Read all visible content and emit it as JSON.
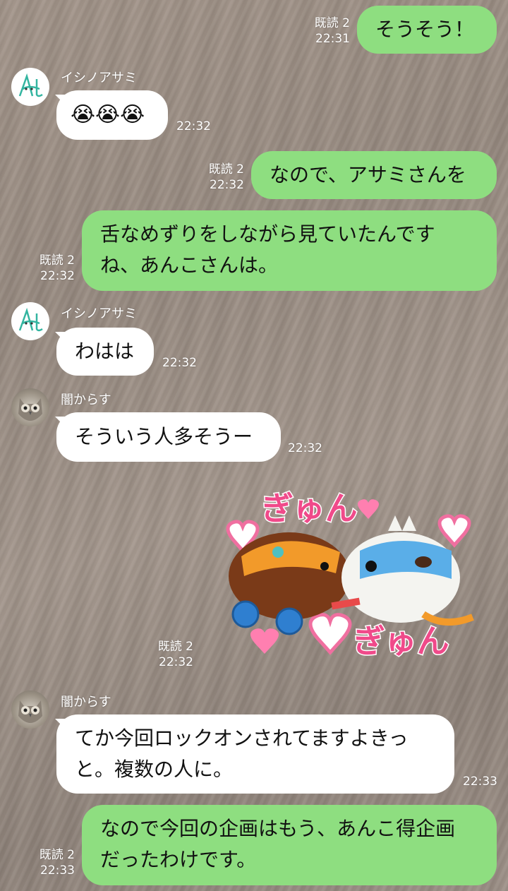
{
  "messages": [
    {
      "dir": "out",
      "read": "既読 2",
      "time": "22:31",
      "text": "そうそう！"
    },
    {
      "dir": "in",
      "sender": "イシノアサミ",
      "text": "😭😭😭",
      "time": "22:32"
    },
    {
      "dir": "out",
      "read": "既読 2",
      "time": "22:32",
      "text": "なので、アサミさんを"
    },
    {
      "dir": "out",
      "read": "既読 2",
      "time": "22:32",
      "line1": "舌なめずりをしながら見ていたんです",
      "line2": "ね、あんこさんは。"
    },
    {
      "dir": "in",
      "sender": "イシノアサミ",
      "text": "わはは",
      "time": "22:32"
    },
    {
      "dir": "in",
      "sender": "闇からす",
      "text": "そういう人多そうー",
      "time": "22:32"
    },
    {
      "dir": "out",
      "type": "sticker",
      "read": "既読 2",
      "time": "22:32",
      "sticker_text_top": "ぎゅん",
      "sticker_text_bottom": "ぎゅん"
    },
    {
      "dir": "in",
      "sender": "闇からす",
      "line1": "てか今回ロックオンされてますよきっ",
      "line2": "と。複数の人に。",
      "time": "22:33"
    },
    {
      "dir": "out",
      "read": "既読 2",
      "time": "22:33",
      "line1": "なので今回の企画はもう、あんこ得企画",
      "line2": "だったわけです。"
    }
  ],
  "avatars": {
    "ishino": "アサミ-avatar",
    "yami": "owl-avatar"
  },
  "colors": {
    "outgoing_bubble": "#8ede80",
    "incoming_bubble": "#ffffff",
    "meta_text": "#ffffff"
  }
}
